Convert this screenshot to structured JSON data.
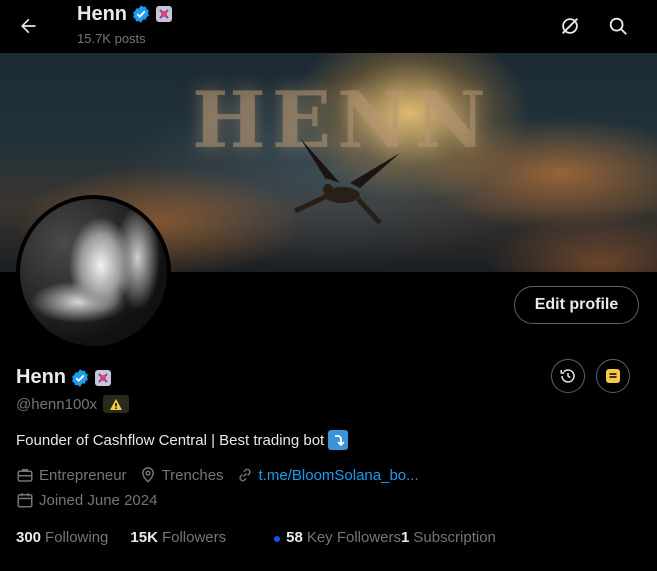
{
  "header": {
    "name": "Henn",
    "posts": "15.7K posts"
  },
  "banner": {
    "text": "HENN"
  },
  "profile": {
    "edit_label": "Edit profile",
    "name": "Henn",
    "handle": "@henn100x",
    "bio": "Founder of Cashflow Central |  Best trading bot",
    "occupation": "Entrepreneur",
    "location": "Trenches",
    "link": "t.me/BloomSolana_bo...",
    "joined": "Joined June 2024"
  },
  "stats": {
    "following_count": "300",
    "following_label": "Following",
    "followers_count": "15K",
    "followers_label": "Followers",
    "key_followers_count": "58",
    "key_followers_label": "Key Followers",
    "subscription_count": "1",
    "subscription_label": "Subscription"
  },
  "colors": {
    "verified": "#1d9bf0",
    "link": "#1d9bf0",
    "note_button": "#f7c948",
    "warning": "#f7c948"
  },
  "icons": {
    "back": "back-arrow-icon",
    "grok": "grok-icon",
    "search": "search-icon",
    "verified": "verified-badge-icon",
    "affiliate": "affiliate-badge-icon",
    "history": "history-icon",
    "note": "note-icon",
    "warning": "warning-icon",
    "briefcase": "briefcase-icon",
    "location": "location-pin-icon",
    "link": "link-icon",
    "calendar": "calendar-icon"
  }
}
